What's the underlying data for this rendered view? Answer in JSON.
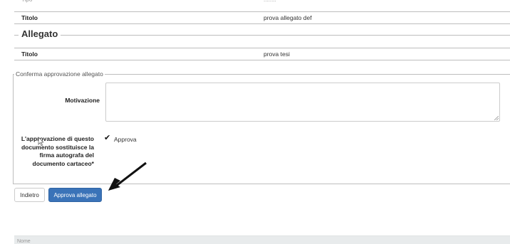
{
  "document": {
    "top_row_value_partial": "........",
    "title_label": "Titolo",
    "title_value": "prova allegato def"
  },
  "attachment": {
    "section_title": "Allegato",
    "title_label": "Titolo",
    "title_value": "prova tesi"
  },
  "approval": {
    "legend": "Conferma approvazione allegato",
    "reason_label": "Motivazione",
    "reason_value": "",
    "signature_label": "L'approvazione di questo documento sostituisce la firma autografa del documento cartaceo*",
    "approve_checked": true,
    "approve_label": "Approva"
  },
  "actions": {
    "back_label": "Indietro",
    "approve_label": "Approva allegato"
  },
  "footer": {
    "column_header": "Nome"
  },
  "icons": {
    "check": "checkmark-icon",
    "arrow": "annotation-arrow",
    "cursor": "mouse-cursor-icon"
  },
  "colors": {
    "primary_button": "#3a73b8",
    "border": "#bdbdbd",
    "footer_bg": "#e8ebec"
  }
}
